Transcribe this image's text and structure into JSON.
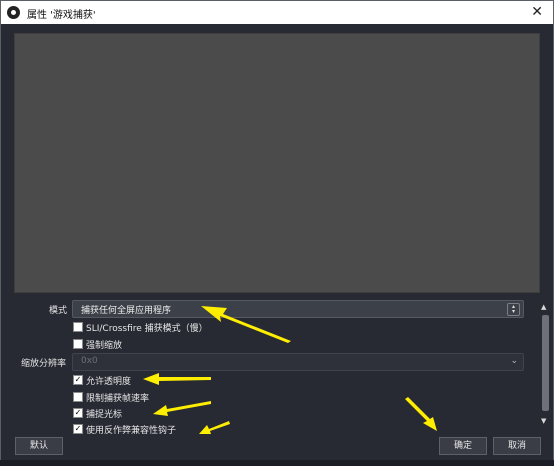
{
  "window": {
    "title": "属性 '游戏捕获'",
    "close_glyph": "✕"
  },
  "fields": {
    "mode": {
      "label": "模式",
      "value": "捕获任何全屏应用程序"
    },
    "sli_label": "SLI/Crossfire 捕获模式（慢）",
    "sli_checked": false,
    "force_scaling": {
      "label": "强制缩放",
      "checked": false
    },
    "scale_resolution": {
      "label": "缩放分辨率",
      "value": "0x0"
    },
    "allow_transparency": {
      "label": "允许透明度",
      "checked": true
    },
    "limit_fps": {
      "label": "限制捕获帧速率",
      "checked": false
    },
    "capture_cursor": {
      "label": "捕捉光标",
      "checked": true
    },
    "anticheat_hook": {
      "label": "使用反作弊兼容性钩子",
      "checked": true
    }
  },
  "buttons": {
    "defaults": "默认",
    "ok": "确定",
    "cancel": "取消"
  },
  "annotations": {
    "arrow_color": "#ffee00"
  },
  "colors": {
    "background": "#272a33",
    "preview": "#4b4b4b"
  }
}
